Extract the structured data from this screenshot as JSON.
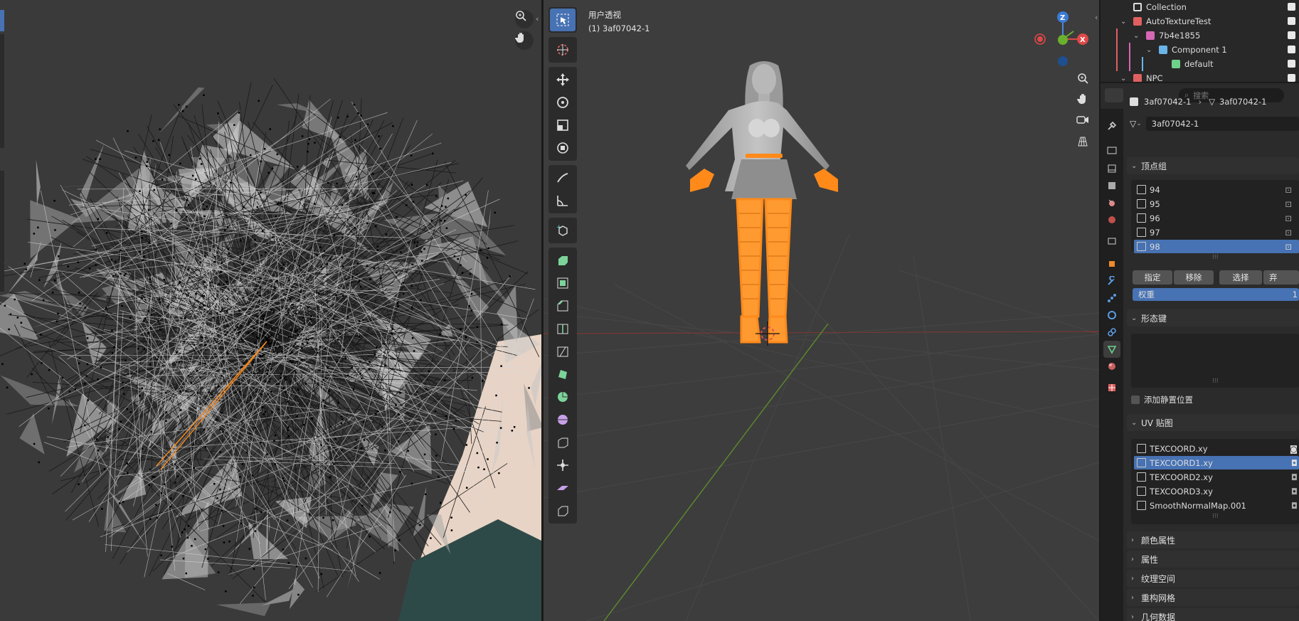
{
  "uv_editor": {
    "tool_icons": [
      "zoom-icon",
      "hand-pan-icon"
    ]
  },
  "viewport": {
    "view_name": "用户透视",
    "object_label": "(1) 3af07042-1",
    "gizmo": {
      "z": "Z",
      "x": "X"
    }
  },
  "outliner": {
    "rows": [
      {
        "label": "Collection",
        "color": "#e06060"
      },
      {
        "label": "AutoTextureTest",
        "color": "#e06060"
      },
      {
        "label": "7b4e1855",
        "color": "#d667b5"
      },
      {
        "label": "Component 1",
        "color": "#6ab4e8"
      },
      {
        "label": "default",
        "color": "#6ed089"
      },
      {
        "label": "NPC",
        "color": "#e06060"
      }
    ]
  },
  "properties": {
    "search_placeholder": "搜索",
    "breadcrumb": {
      "object": "3af07042-1",
      "mesh": "3af07042-1"
    },
    "mesh_name": "3af07042-1",
    "vertex_groups": {
      "title": "顶点组",
      "items": [
        "94",
        "95",
        "96",
        "97",
        "98"
      ],
      "selected": 4,
      "buttons": [
        "指定",
        "移除",
        "选择",
        "弃"
      ],
      "weight_label": "权重",
      "weight_value": "1"
    },
    "shape_keys": {
      "title": "形态键",
      "relative_label": "添加静置位置"
    },
    "uv_maps": {
      "title": "UV 贴图",
      "items": [
        "TEXCOORD.xy",
        "TEXCOORD1.xy",
        "TEXCOORD2.xy",
        "TEXCOORD3.xy",
        "SmoothNormalMap.001"
      ],
      "selected": 1
    },
    "collapsed_panels": [
      "颜色属性",
      "属性",
      "纹理空间",
      "重构网格",
      "几何数据"
    ]
  },
  "colors": {
    "accent": "#4772b3",
    "selection": "#ff8a1a"
  }
}
